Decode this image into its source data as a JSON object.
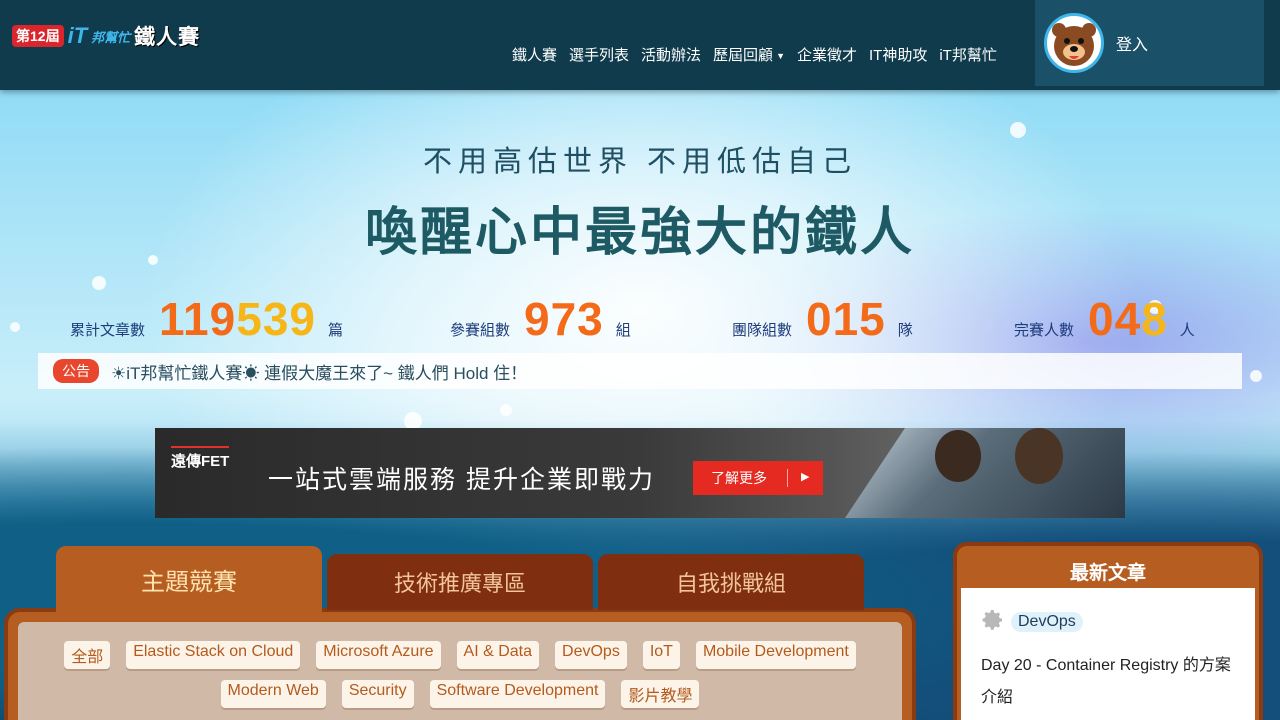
{
  "header": {
    "logo": {
      "edition": "第12屆",
      "brand_it": "iT",
      "brand_bang": "邦幫忙",
      "title": "鐵人賽"
    },
    "nav": [
      {
        "label": "鐵人賽"
      },
      {
        "label": "選手列表"
      },
      {
        "label": "活動辦法"
      },
      {
        "label": "歷屆回顧",
        "has_dropdown": true
      },
      {
        "label": "企業徵才"
      },
      {
        "label": "IT神助攻"
      },
      {
        "label": "iT邦幫忙"
      }
    ],
    "login_label": "登入"
  },
  "hero": {
    "slogan": "不用高估世界 不用低估自己",
    "headline": "喚醒心中最強大的鐵人"
  },
  "stats": [
    {
      "label": "累計文章數",
      "num_a": "119",
      "num_b": "539",
      "unit": "篇"
    },
    {
      "label": "參賽組數",
      "num_a": "973",
      "num_b": "",
      "unit": "組"
    },
    {
      "label": "團隊組數",
      "num_a": "015",
      "num_b": "",
      "unit": "隊"
    },
    {
      "label": "完賽人數",
      "num_a": "04",
      "num_b": "8",
      "unit": "人"
    }
  ],
  "announcement": {
    "badge": "公告",
    "text": "☀iT邦幫忙鐵人賽☀ 連假大魔王來了~ 鐵人們 Hold 住！"
  },
  "banner": {
    "logo": "遠傳FET",
    "text": "一站式雲端服務  提升企業即戰力",
    "button": "了解更多"
  },
  "tabs": [
    {
      "label": "主題競賽",
      "active": true
    },
    {
      "label": "技術推廣專區",
      "active": false
    },
    {
      "label": "自我挑戰組",
      "active": false
    }
  ],
  "topics_row1": [
    "全部",
    "Elastic Stack on Cloud",
    "Microsoft Azure",
    "AI & Data",
    "DevOps",
    "IoT",
    "Mobile Development"
  ],
  "topics_row2": [
    "Modern Web",
    "Security",
    "Software Development",
    "影片教學"
  ],
  "sidebar": {
    "title": "最新文章",
    "latest": {
      "category": "DevOps",
      "title": "Day 20 - Container Registry 的方案介紹"
    }
  },
  "colors": {
    "header_bg": "#0f3b4c",
    "accent_orange": "#f36a18",
    "accent_yellow": "#f7b618",
    "panel_brown": "#b65e21"
  }
}
